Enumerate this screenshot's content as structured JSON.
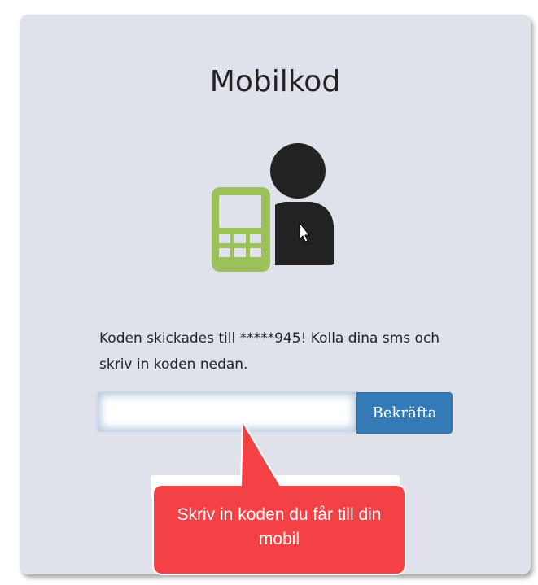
{
  "page": {
    "title": "Mobilkod",
    "message": "Koden skickades till *****945! Kolla dina sms och skriv in koden nedan.",
    "code_input": {
      "value": "",
      "placeholder": ""
    },
    "confirm_label": "Bekräfta"
  },
  "callout": {
    "text": "Skriv in koden du får till din mobil",
    "color": "#f44145"
  },
  "icons": {
    "illustration": "mobile-person-icon",
    "cursor": "mouse-cursor-icon"
  },
  "colors": {
    "card_background": "#dfe2ea",
    "button": "#337ab7",
    "phone": "#9cc15a",
    "person": "#222222"
  }
}
